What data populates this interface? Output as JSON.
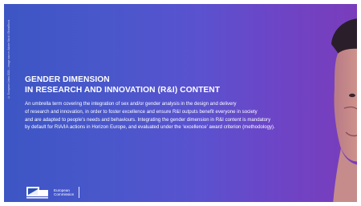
{
  "slide": {
    "credit": "© European Union 2021 – Image source: Adobe Stock / GlobalStock",
    "title_lines": [
      "GENDER DIMENSION",
      "IN RESEARCH AND INNOVATION (R&I) CONTENT"
    ],
    "body_lines": [
      "An umbrella term covering the integration of sex and/or gender analysis in the design and delivery",
      "of research and innovation, in order to foster excellence and ensure R&I outputs benefit everyone in society",
      "and are adapted to people’s needs and behaviours. Integrating the gender dimension in R&I content is mandatory",
      "by default for RIA/IA actions in Horizon Europe, and evaluated under the ‘excellence’ award criterion (methodology)."
    ],
    "logo": {
      "line1": "European",
      "line2": "Commission"
    }
  },
  "colors": {
    "gradient_left": "#3d56c4",
    "gradient_right": "#7a3cbb",
    "text": "#ffffff"
  },
  "icons": {
    "logo": "european-commission-logo-icon",
    "photo": "person-photo"
  }
}
